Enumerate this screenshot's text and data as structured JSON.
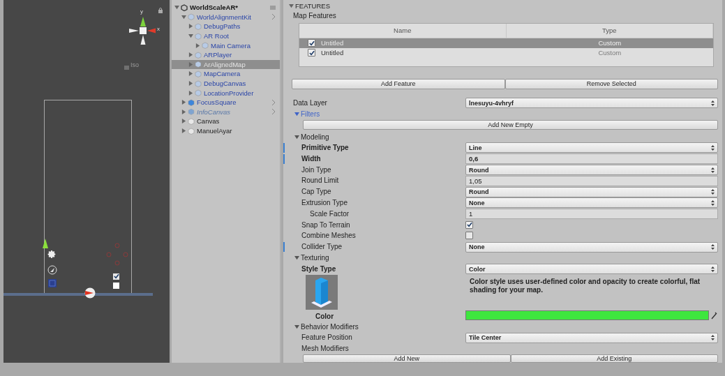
{
  "scene_view": {
    "axis_labels": [
      "y",
      "x"
    ],
    "projection_label": "Iso",
    "toggles": [
      {
        "checked": true
      },
      {
        "checked": false
      }
    ]
  },
  "hierarchy": {
    "scene": "WorldScaleAR*",
    "expanded": true,
    "items": [
      {
        "label": "WorldAlignmentKit",
        "kind": "prefab",
        "expanded": true,
        "selected": false,
        "disabled": false,
        "chevron": true,
        "children": [
          {
            "label": "DebugPaths",
            "kind": "prefab",
            "expanded": false,
            "selected": false,
            "disabled": false,
            "chevron": false
          },
          {
            "label": "AR Root",
            "kind": "prefab",
            "expanded": true,
            "selected": false,
            "disabled": false,
            "chevron": false,
            "children": [
              {
                "label": "Main Camera",
                "kind": "prefab",
                "expanded": false,
                "selected": false,
                "disabled": false,
                "chevron": false
              }
            ]
          },
          {
            "label": "ARPlayer",
            "kind": "prefab",
            "expanded": false,
            "selected": false,
            "disabled": false,
            "chevron": false
          },
          {
            "label": "ArAlignedMap",
            "kind": "prefab",
            "expanded": false,
            "selected": true,
            "disabled": false,
            "chevron": false
          },
          {
            "label": "MapCamera",
            "kind": "prefab",
            "expanded": false,
            "selected": false,
            "disabled": false,
            "chevron": false
          },
          {
            "label": "DebugCanvas",
            "kind": "prefab",
            "expanded": false,
            "selected": false,
            "disabled": false,
            "chevron": false
          },
          {
            "label": "LocationProvider",
            "kind": "prefab",
            "expanded": false,
            "selected": false,
            "disabled": false,
            "chevron": false
          }
        ]
      },
      {
        "label": "FocusSquare",
        "kind": "prefab_root",
        "expanded": false,
        "selected": false,
        "disabled": false,
        "chevron": true
      },
      {
        "label": "InfoCanvas",
        "kind": "prefab_root",
        "expanded": false,
        "selected": false,
        "disabled": true,
        "chevron": true
      },
      {
        "label": "Canvas",
        "kind": "object",
        "expanded": false,
        "selected": false,
        "disabled": false,
        "chevron": false
      },
      {
        "label": "ManuelAyar",
        "kind": "object",
        "expanded": false,
        "selected": false,
        "disabled": false,
        "chevron": false
      }
    ]
  },
  "inspector": {
    "section_title": "FEATURES",
    "map_features": {
      "label": "Map Features",
      "columns": [
        "Name",
        "Type"
      ],
      "rows": [
        {
          "checked": true,
          "name": "Untitled",
          "type": "Custom",
          "selected": true
        },
        {
          "checked": true,
          "name": "Untitled",
          "type": "Custom",
          "selected": false
        }
      ],
      "buttons": [
        "Add Feature",
        "Remove Selected"
      ]
    },
    "data_layer": {
      "label": "Data Layer",
      "value": "lnesuyu-4vhryf"
    },
    "filters": {
      "title": "Filters",
      "expanded": true,
      "button": "Add New Empty"
    },
    "modeling": {
      "title": "Modeling",
      "expanded": true,
      "properties": [
        {
          "label": "Primitive Type",
          "kind": "dropdown",
          "value": "Line",
          "bold": true,
          "modified": true
        },
        {
          "label": "Width",
          "kind": "text",
          "value": "0,6",
          "bold": true,
          "modified": true
        },
        {
          "label": "Join Type",
          "kind": "dropdown",
          "value": "Round",
          "bold": false,
          "modified": false
        },
        {
          "label": "Round Limit",
          "kind": "text",
          "value": "1,05",
          "bold": false,
          "modified": false
        },
        {
          "label": "Cap Type",
          "kind": "dropdown",
          "value": "Round",
          "bold": false,
          "modified": false
        },
        {
          "label": "Extrusion Type",
          "kind": "dropdown",
          "value": "None",
          "bold": false,
          "modified": false,
          "children": [
            {
              "label": "Scale Factor",
              "kind": "text",
              "value": "1",
              "bold": false,
              "modified": false
            }
          ]
        },
        {
          "label": "Snap To Terrain",
          "kind": "checkbox",
          "checked": true,
          "bold": false,
          "modified": false
        },
        {
          "label": "Combine Meshes",
          "kind": "checkbox",
          "checked": false,
          "bold": false,
          "modified": false
        },
        {
          "label": "Collider Type",
          "kind": "dropdown",
          "value": "None",
          "bold": false,
          "modified": true
        }
      ]
    },
    "texturing": {
      "title": "Texturing",
      "expanded": true,
      "style_type": {
        "label": "Style Type",
        "value": "Color"
      },
      "description": "Color style uses user-defined color and opacity to create colorful, flat shading for your map.",
      "color": {
        "label": "Color",
        "color": "#3ee63e"
      }
    },
    "behavior_modifiers": {
      "title": "Behavior Modifiers",
      "expanded": true,
      "feature_position": {
        "label": "Feature Position",
        "value": "Tile Center"
      },
      "mesh_modifiers": {
        "label": "Mesh Modifiers",
        "buttons": [
          "Add New",
          "Add Existing"
        ]
      }
    }
  }
}
